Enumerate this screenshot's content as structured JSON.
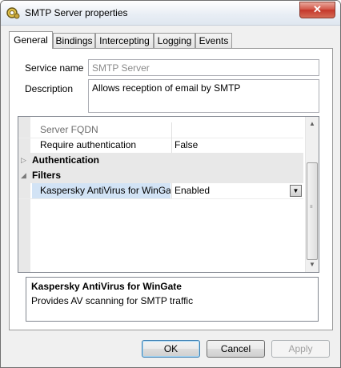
{
  "window": {
    "title": "SMTP Server properties",
    "close_symbol": "✕"
  },
  "tabs": [
    {
      "label": "General",
      "active": true
    },
    {
      "label": "Bindings",
      "active": false
    },
    {
      "label": "Intercepting",
      "active": false
    },
    {
      "label": "Logging",
      "active": false
    },
    {
      "label": "Events",
      "active": false
    }
  ],
  "general": {
    "service_name_label": "Service name",
    "service_name_value": "SMTP Server",
    "description_label": "Description",
    "description_value": "Allows reception of email by SMTP"
  },
  "property_grid": {
    "rows": [
      {
        "kind": "property",
        "name": "Server FQDN",
        "value": "",
        "dim": true
      },
      {
        "kind": "property",
        "name": "Require authentication",
        "value": "False"
      },
      {
        "kind": "category",
        "name": "Authentication",
        "expanded": false
      },
      {
        "kind": "category",
        "name": "Filters",
        "expanded": true
      },
      {
        "kind": "property",
        "name": "Kaspersky AntiVirus for WinGate",
        "value": "Enabled",
        "selected": true
      }
    ]
  },
  "help": {
    "title": "Kaspersky AntiVirus for WinGate",
    "description": "Provides AV scanning for SMTP traffic"
  },
  "buttons": {
    "ok": "OK",
    "cancel": "Cancel",
    "apply": "Apply"
  },
  "icons": {
    "app": "gear-icon",
    "expand": "triangle-right-icon",
    "collapse": "triangle-down-icon",
    "dropdown": "triangle-down-icon"
  }
}
